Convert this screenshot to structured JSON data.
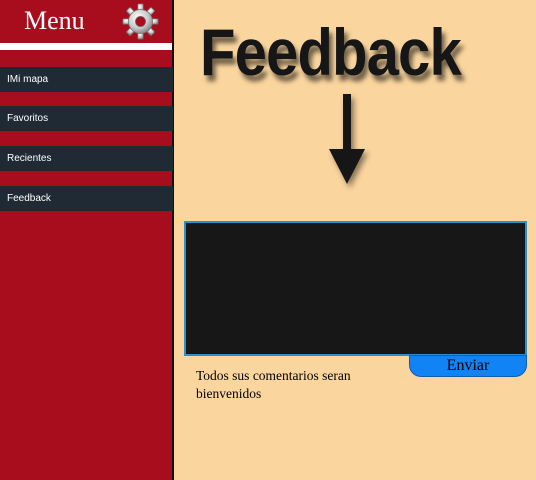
{
  "sidebar": {
    "title": "Menu",
    "settings_icon": "gear-icon",
    "items": [
      {
        "label": "IMi mapa"
      },
      {
        "label": "Favoritos"
      },
      {
        "label": "Recientes"
      },
      {
        "label": "Feedback"
      }
    ]
  },
  "main": {
    "heading": "Feedback",
    "arrow_icon": "arrow-down-icon",
    "feedback_value": "",
    "send_label": "Enviar",
    "note": "Todos sus comentarios seran bienvenidos"
  },
  "colors": {
    "sidebar_bg": "#a80d1e",
    "nav_item_bg": "#1f2a34",
    "page_bg": "#fad59e",
    "textarea_bg": "#171717",
    "textarea_border": "#2e8fce",
    "button_bg": "#1183f5"
  }
}
